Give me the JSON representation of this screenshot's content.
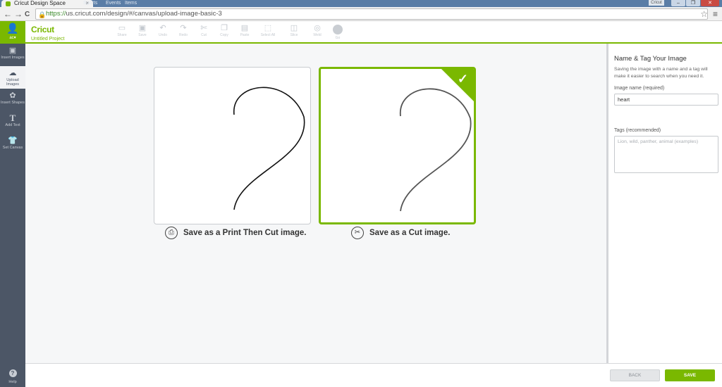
{
  "browser": {
    "tab_title": "Cricut Design Space",
    "tab_close": "×",
    "ghost_tabs": [
      "Sports",
      "Events",
      "Items"
    ],
    "user_chip": "Cricut",
    "window_buttons": [
      "–",
      "❐",
      "✕"
    ],
    "url_scheme": "https://",
    "url_rest": "us.cricut.com/design/#/canvas/upload-image-basic-3",
    "nav": {
      "back": "←",
      "forward": "→",
      "reload": "C"
    },
    "star": "☆",
    "menu": "≡"
  },
  "header": {
    "account_label": "ac▾",
    "brand": "Cricut",
    "project": "Untitled Project",
    "tools": [
      {
        "icon": "folder-icon",
        "glyph": "▭",
        "label": "Share"
      },
      {
        "icon": "save-icon",
        "glyph": "▣",
        "label": "Save"
      },
      {
        "icon": "undo-icon",
        "glyph": "↶",
        "label": "Undo"
      },
      {
        "icon": "redo-icon",
        "glyph": "↷",
        "label": "Redo"
      },
      {
        "icon": "cut-icon",
        "glyph": "✄",
        "label": "Cut"
      },
      {
        "icon": "copy-icon",
        "glyph": "❐",
        "label": "Copy"
      },
      {
        "icon": "paste-icon",
        "glyph": "▤",
        "label": "Paste"
      },
      {
        "icon": "select-all-icon",
        "glyph": "⬚",
        "label": "Select All"
      },
      {
        "icon": "slice-icon",
        "glyph": "◫",
        "label": "Slice"
      },
      {
        "icon": "weld-icon",
        "glyph": "◎",
        "label": "Weld"
      }
    ],
    "go_label": "Go"
  },
  "sidebar": {
    "items": [
      {
        "label": "Insert Images",
        "glyph": "▣"
      },
      {
        "label": "Upload Images",
        "glyph": "☁"
      },
      {
        "label": "Insert Shapes",
        "glyph": "✿"
      },
      {
        "label": "Add Text",
        "glyph": "T"
      },
      {
        "label": "Set Canvas",
        "glyph": "👕"
      }
    ],
    "help_label": "Help",
    "help_glyph": "?"
  },
  "options": {
    "print_then_cut": {
      "label": "Save as a Print Then Cut image.",
      "glyph": "⎙"
    },
    "cut": {
      "label": "Save as a Cut image.",
      "glyph": "✂"
    },
    "selected_check": "✓"
  },
  "panel": {
    "title": "Name & Tag Your Image",
    "description": "Saving the image with a name and a tag will make it easier to search when you need it.",
    "name_label": "Image name (required)",
    "name_value": "heart",
    "tags_label": "Tags (recommended)",
    "tags_placeholder": "Lion, wild, panther, animal (examples)"
  },
  "footer": {
    "back_label": "BACK",
    "save_label": "SAVE"
  },
  "colors": {
    "brand_green": "#7ab800",
    "sidebar": "#4c5666"
  }
}
